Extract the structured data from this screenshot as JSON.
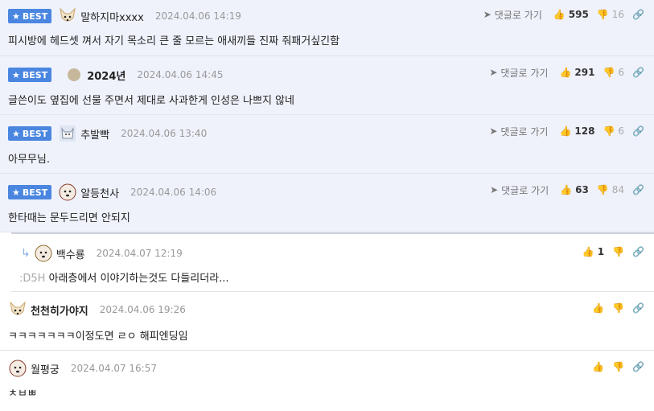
{
  "ui": {
    "best_label": "BEST",
    "reply_label": "댓글로 가기"
  },
  "comments": [
    {
      "nick": "말하지마xxxx",
      "date": "2024.04.06 14:19",
      "text": "피시방에 헤드셋 껴서 자기 목소리 큰 줄 모르는 애새끼들 진짜 줘패거싶긴함",
      "likes": "595",
      "dislikes": "16",
      "avatar": "dog-avatar-icon"
    },
    {
      "nick": "2024년",
      "date": "2024.04.06 14:45",
      "text": "글쓴이도 옆집에 선물 주면서 제대로 사과한게 인성은 나쁘지 않네",
      "likes": "291",
      "dislikes": "6",
      "avatar": "dot-avatar-icon"
    },
    {
      "nick": "추발빡",
      "date": "2024.04.06 13:40",
      "text": "아무무님.",
      "likes": "128",
      "dislikes": "6",
      "avatar": "cat-avatar-icon"
    },
    {
      "nick": "알등천사",
      "date": "2024.04.06 14:06",
      "text": "한타때는 문두드리면 안되지",
      "likes": "63",
      "dislikes": "84",
      "avatar": "puppy-avatar-icon"
    }
  ],
  "reply": {
    "nick": "백수룡",
    "date": "2024.04.07 12:19",
    "prefix": ":D5H",
    "text": "아래층에서 이야기하는것도 다들리더라...",
    "likes": "1",
    "dislikes": ""
  },
  "normal": [
    {
      "nick": "천천히가야지",
      "date": "2024.04.06 19:26",
      "text": "ㅋㅋㅋㅋㅋㅋㅋ이정도면 ㄹㅇ 해피엔딩임"
    },
    {
      "nick": "월평궁",
      "date": "2024.04.07 16:57",
      "text": "ㅊㅂㅃ"
    }
  ]
}
